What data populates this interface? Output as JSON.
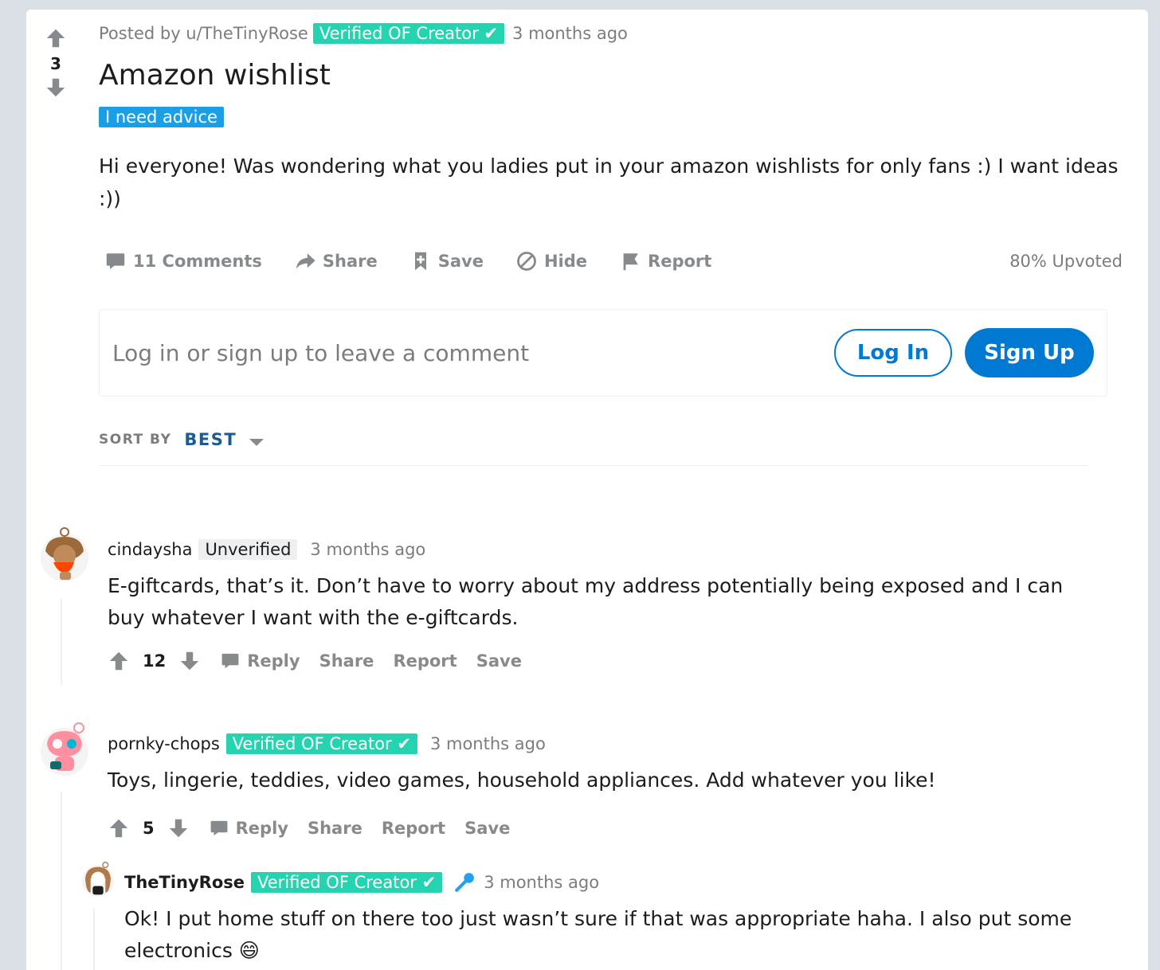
{
  "post": {
    "score": "3",
    "posted_by": "Posted by u/TheTinyRose",
    "author_flair": "Verified OF Creator ✔",
    "time": "3 months ago",
    "title": "Amazon wishlist",
    "post_flair": "I need advice",
    "body": "Hi everyone! Was wondering what you ladies put in your amazon wishlists for only fans :) I want ideas :))",
    "actions": {
      "comments": "11 Comments",
      "share": "Share",
      "save": "Save",
      "hide": "Hide",
      "report": "Report"
    },
    "upvoted": "80% Upvoted"
  },
  "login_prompt": {
    "text": "Log in or sign up to leave a comment",
    "login_label": "Log In",
    "signup_label": "Sign Up"
  },
  "sort": {
    "label": "SORT BY",
    "value": "BEST"
  },
  "comments": [
    {
      "user": "cindaysha",
      "badge": "Unverified",
      "time": "3 months ago",
      "body": "E-giftcards, that’s it. Don’t have to worry about my address potentially being exposed and I can buy whatever I want with the e-giftcards.",
      "score": "12",
      "reply": "Reply",
      "share": "Share",
      "report": "Report",
      "save": "Save"
    },
    {
      "user": "pornky-chops",
      "badge": "Verified OF Creator ✔",
      "time": "3 months ago",
      "body": "Toys, lingerie, teddies, video games, household appliances. Add whatever you like!",
      "score": "5",
      "reply": "Reply",
      "share": "Share",
      "report": "Report",
      "save": "Save"
    },
    {
      "user": "TheTinyRose",
      "badge": "Verified OF Creator ✔",
      "time": "3 months ago",
      "body": "Ok! I put home stuff on there too just wasn’t sure if that was appropriate haha. I also put some electronics 😄"
    }
  ],
  "colors": {
    "background": "#dae0e6",
    "accent_blue": "#0079d3",
    "verified_green": "#24d4b0",
    "flair_blue": "#1a9ee6",
    "icon_gray": "#878a8c"
  }
}
